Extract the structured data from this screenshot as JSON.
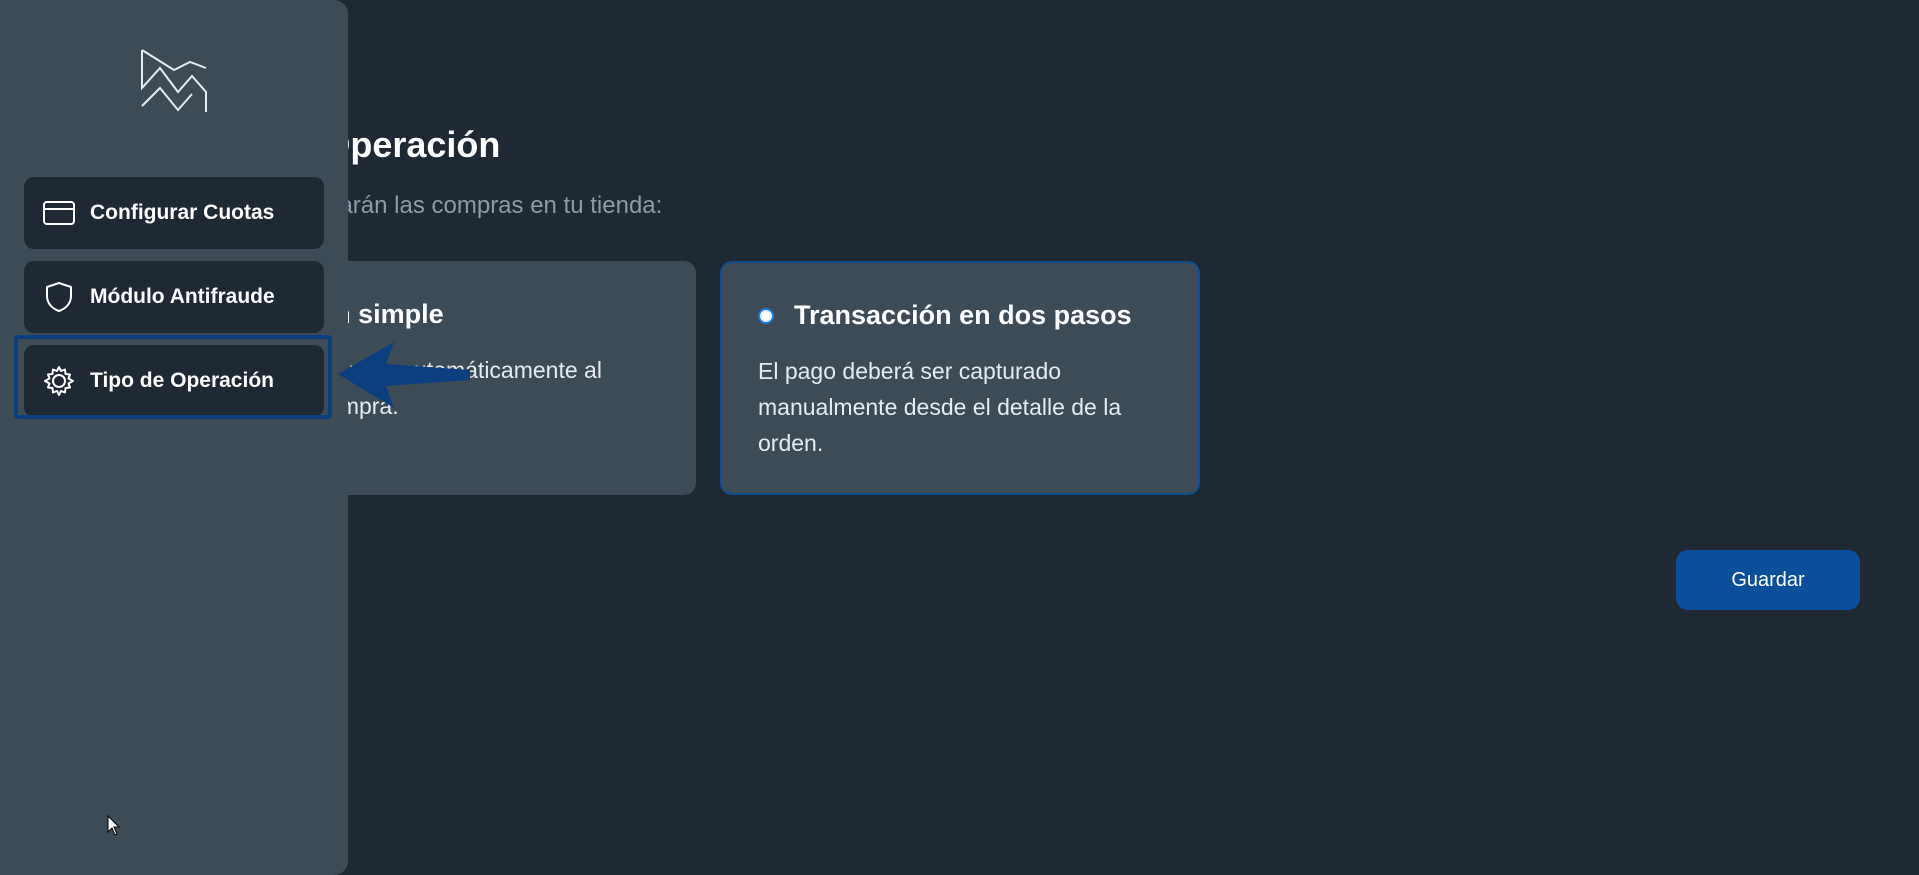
{
  "main": {
    "title": "Tipo de Operación",
    "subtitle": "Define cómo se operarán las compras en tu tienda:",
    "options": [
      {
        "title": "Transacción simple",
        "description": "El pago será capturado automáticamente al momento de la compra.",
        "selected": false
      },
      {
        "title": "Transacción en dos pasos",
        "description": "El pago deberá ser capturado manualmente desde el detalle de la orden.",
        "selected": true
      }
    ],
    "save_label": "Guardar"
  },
  "sidebar": {
    "logo_icon": "brand-logo-icon",
    "items": [
      {
        "label": "Configurar Cuotas",
        "icon": "credit-card-icon",
        "active": false
      },
      {
        "label": "Módulo Antifraude",
        "icon": "shield-icon",
        "active": false
      },
      {
        "label": "Tipo de Operación",
        "icon": "gear-icon",
        "active": true
      }
    ]
  },
  "colors": {
    "background": "#1f2933",
    "panel": "#3d4b57",
    "accent": "#0b4f9a",
    "radio": "#1f7fe0",
    "active_frame": "#0b3f80"
  }
}
